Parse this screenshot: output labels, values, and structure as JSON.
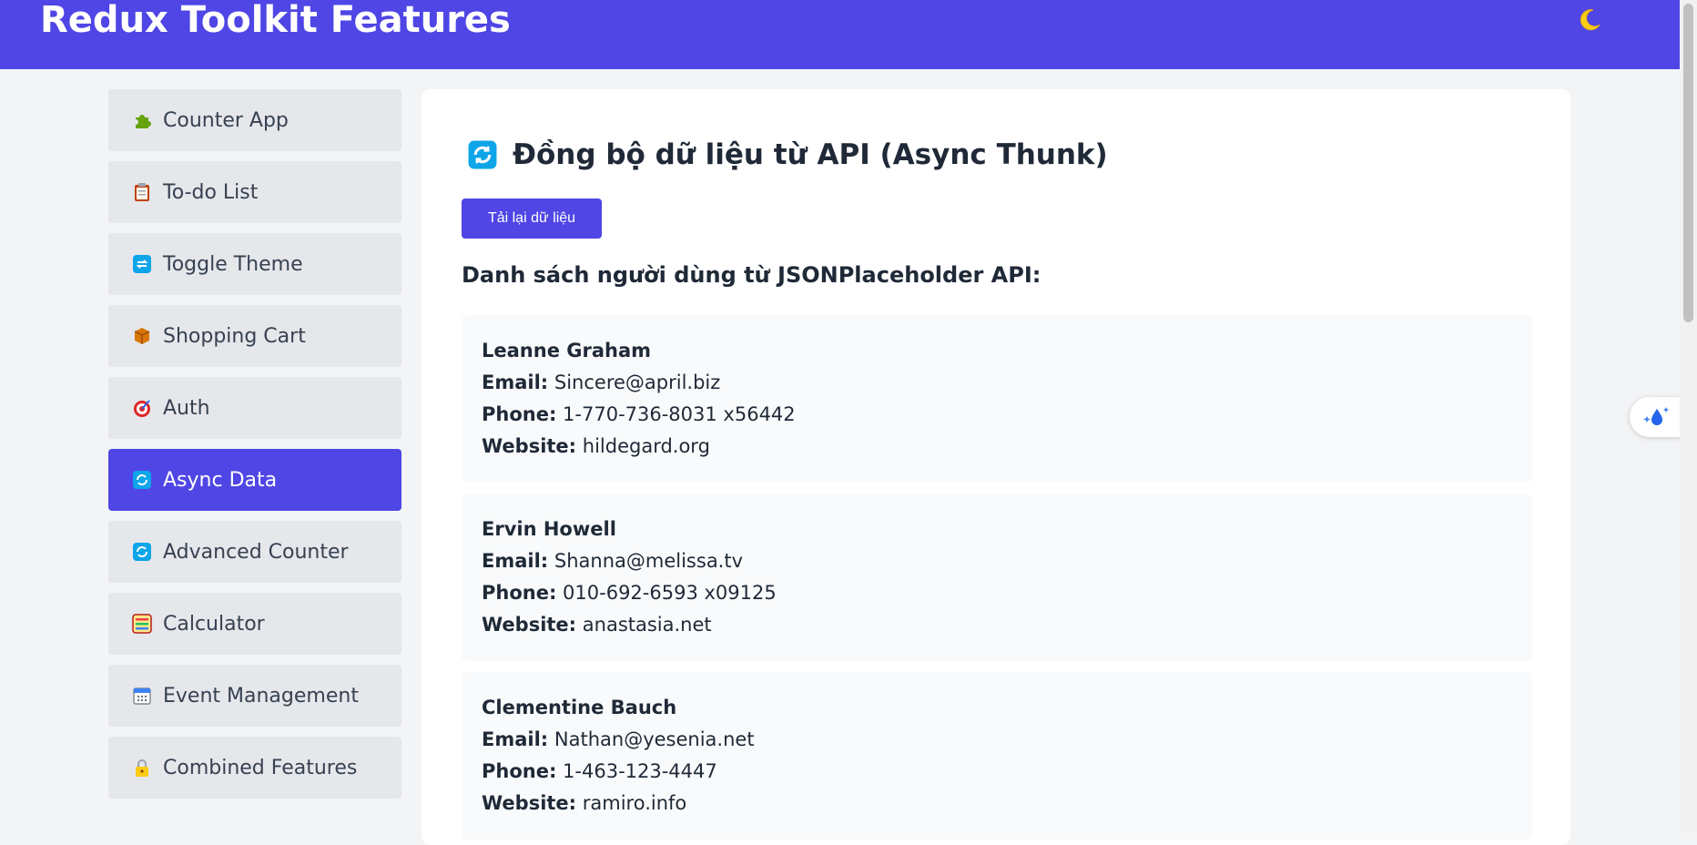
{
  "header": {
    "title": "Redux Toolkit Features",
    "theme_icon": "moon-icon"
  },
  "sidebar": {
    "items": [
      {
        "label": "Counter App",
        "icon": "puzzle-icon"
      },
      {
        "label": "To-do List",
        "icon": "clipboard-icon"
      },
      {
        "label": "Toggle Theme",
        "icon": "repeat-icon"
      },
      {
        "label": "Shopping Cart",
        "icon": "package-icon"
      },
      {
        "label": "Auth",
        "icon": "target-icon"
      },
      {
        "label": "Async Data",
        "icon": "refresh-icon",
        "active": true
      },
      {
        "label": "Advanced Counter",
        "icon": "refresh-icon"
      },
      {
        "label": "Calculator",
        "icon": "abacus-icon"
      },
      {
        "label": "Event Management",
        "icon": "calendar-icon"
      },
      {
        "label": "Combined Features",
        "icon": "lock-icon"
      }
    ]
  },
  "main": {
    "title": "Đồng bộ dữ liệu từ API (Async Thunk)",
    "reload_label": "Tải lại dữ liệu",
    "list_heading": "Danh sách người dùng từ JSONPlaceholder API:",
    "field_labels": {
      "email": "Email:",
      "phone": "Phone:",
      "website": "Website:"
    },
    "users": [
      {
        "name": "Leanne Graham",
        "email": "Sincere@april.biz",
        "phone": "1-770-736-8031 x56442",
        "website": "hildegard.org"
      },
      {
        "name": "Ervin Howell",
        "email": "Shanna@melissa.tv",
        "phone": "010-692-6593 x09125",
        "website": "anastasia.net"
      },
      {
        "name": "Clementine Bauch",
        "email": "Nathan@yesenia.net",
        "phone": "1-463-123-4447",
        "website": "ramiro.info"
      }
    ]
  },
  "colors": {
    "accent": "#4f46e5",
    "sidebar_item_bg": "#e5e7eb",
    "card_bg": "#f9fafb",
    "page_bg": "#f3f4f6"
  }
}
